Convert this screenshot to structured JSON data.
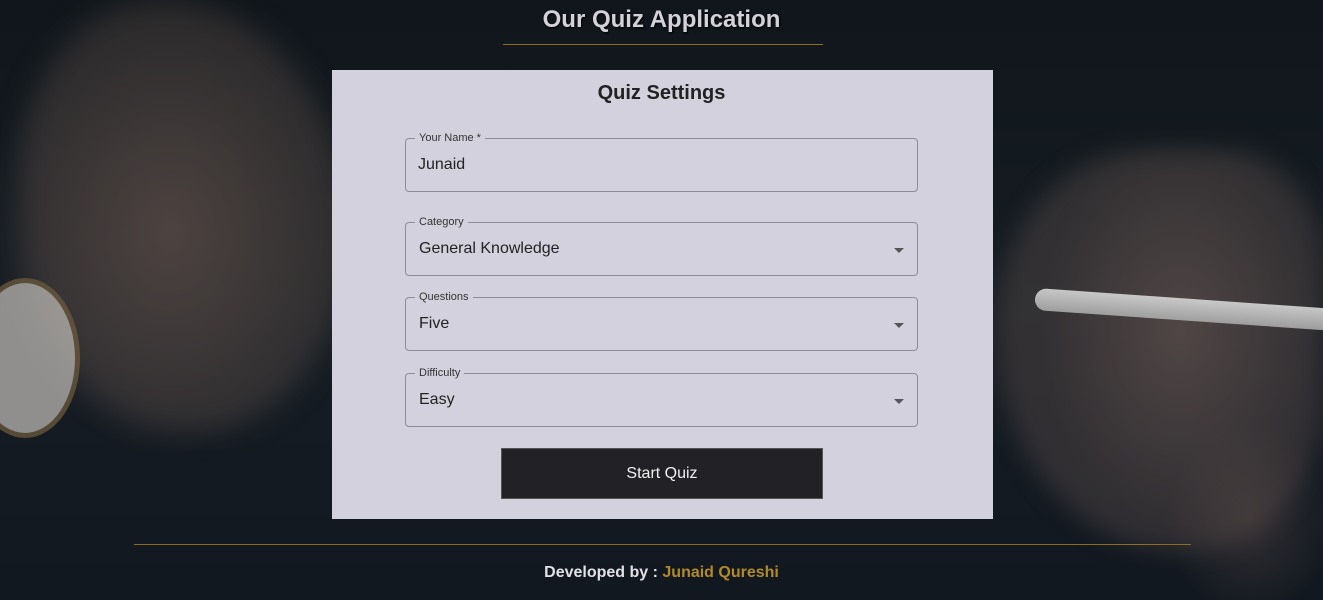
{
  "header": {
    "title": "Our Quiz Application"
  },
  "settings": {
    "title": "Quiz Settings",
    "name_field": {
      "label": "Your Name *",
      "value": "Junaid"
    },
    "category_field": {
      "label": "Category",
      "value": "General Knowledge"
    },
    "questions_field": {
      "label": "Questions",
      "value": "Five"
    },
    "difficulty_field": {
      "label": "Difficulty",
      "value": "Easy"
    },
    "start_label": "Start Quiz"
  },
  "footer": {
    "prefix": "Developed by : ",
    "author": "Junaid Qureshi"
  },
  "colors": {
    "accent": "#b38a2a",
    "card_background": "#d3d1dd",
    "button_background": "#222226"
  },
  "icons": {
    "dropdown": "chevron-down-icon"
  }
}
